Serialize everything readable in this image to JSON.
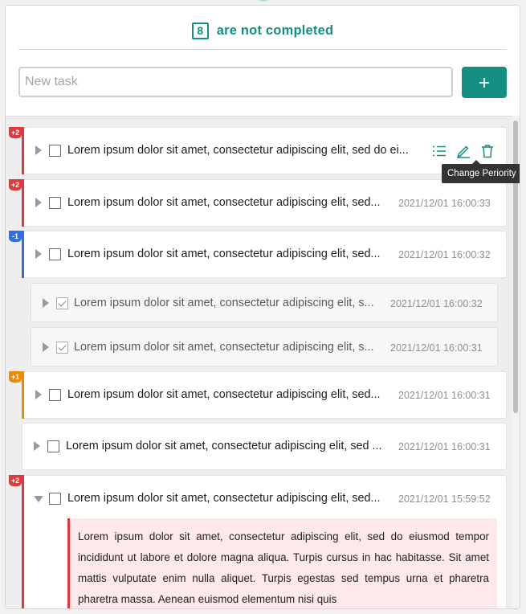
{
  "header": {
    "count": "8",
    "count_label": "are not completed"
  },
  "new_task": {
    "placeholder": "New task",
    "value": "",
    "add_label": "+"
  },
  "tooltip": "Change Periority",
  "tasks": [
    {
      "priority": "+2",
      "priority_color": "#e6363c",
      "title": "Lorem ipsum dolor sit amet, consectetur adipiscing elit, sed do ei...",
      "timestamp": "",
      "checked": false,
      "expanded": false,
      "show_actions": true
    },
    {
      "priority": "+2",
      "priority_color": "#e6363c",
      "title": "Lorem ipsum dolor sit amet, consectetur adipiscing elit, sed...",
      "timestamp": "2021/12/01 16:00:33",
      "checked": false,
      "expanded": false
    },
    {
      "priority": "-1",
      "priority_color": "#2f6fe4",
      "title": "Lorem ipsum dolor sit amet, consectetur adipiscing elit, sed...",
      "timestamp": "2021/12/01 16:00:32",
      "checked": false,
      "expanded": false
    },
    {
      "priority": "",
      "title": "Lorem ipsum dolor sit amet, consectetur adipiscing elit, s...",
      "timestamp": "2021/12/01 16:00:32",
      "checked": true,
      "subtask": true
    },
    {
      "priority": "",
      "title": "Lorem ipsum dolor sit amet, consectetur adipiscing elit, s...",
      "timestamp": "2021/12/01 16:00:31",
      "checked": true,
      "subtask": true
    },
    {
      "priority": "+1",
      "priority_color": "#f08a00",
      "title": "Lorem ipsum dolor sit amet, consectetur adipiscing elit, sed...",
      "timestamp": "2021/12/01 16:00:31",
      "checked": false,
      "expanded": false
    },
    {
      "priority": "",
      "title": "Lorem ipsum dolor sit amet, consectetur adipiscing elit, sed ...",
      "timestamp": "2021/12/01 16:00:31",
      "checked": false,
      "expanded": false
    },
    {
      "priority": "+2",
      "priority_color": "#e6363c",
      "title": "Lorem ipsum dolor sit amet, consectetur adipiscing elit, sed...",
      "timestamp": "2021/12/01 15:59:52",
      "checked": false,
      "expanded": true
    }
  ],
  "description": "Lorem ipsum dolor sit amet, consectetur adipiscing elit, sed do eiusmod tempor incididunt ut labore et dolore magna aliqua. Turpis cursus in hac habitasse. Sit amet mattis vulputate enim nulla aliquet. Turpis egestas sed tempus urna et pharetra pharetra massa. Aenean euismod elementum nisi quis",
  "icons": {
    "add": "plus-icon",
    "subtasks": "list-icon",
    "edit": "pencil-icon",
    "delete": "trash-icon",
    "collapse": "triangle-right-icon",
    "expand": "triangle-down-icon"
  },
  "colors": {
    "accent": "#139082",
    "priority_high": "#e6363c",
    "priority_medium": "#f08a00",
    "priority_low": "#2f6fe4"
  }
}
